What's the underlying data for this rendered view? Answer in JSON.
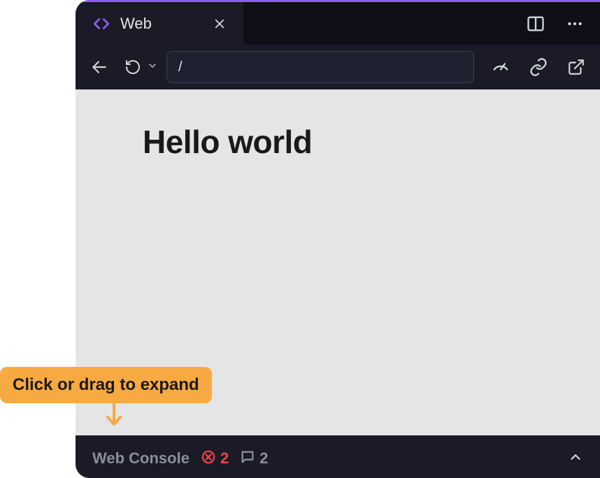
{
  "tab": {
    "title": "Web"
  },
  "urlbar": {
    "value": "/"
  },
  "page": {
    "heading": "Hello world"
  },
  "console": {
    "label": "Web Console",
    "errors": "2",
    "messages": "2"
  },
  "tooltip": {
    "text": "Click or drag to expand"
  }
}
